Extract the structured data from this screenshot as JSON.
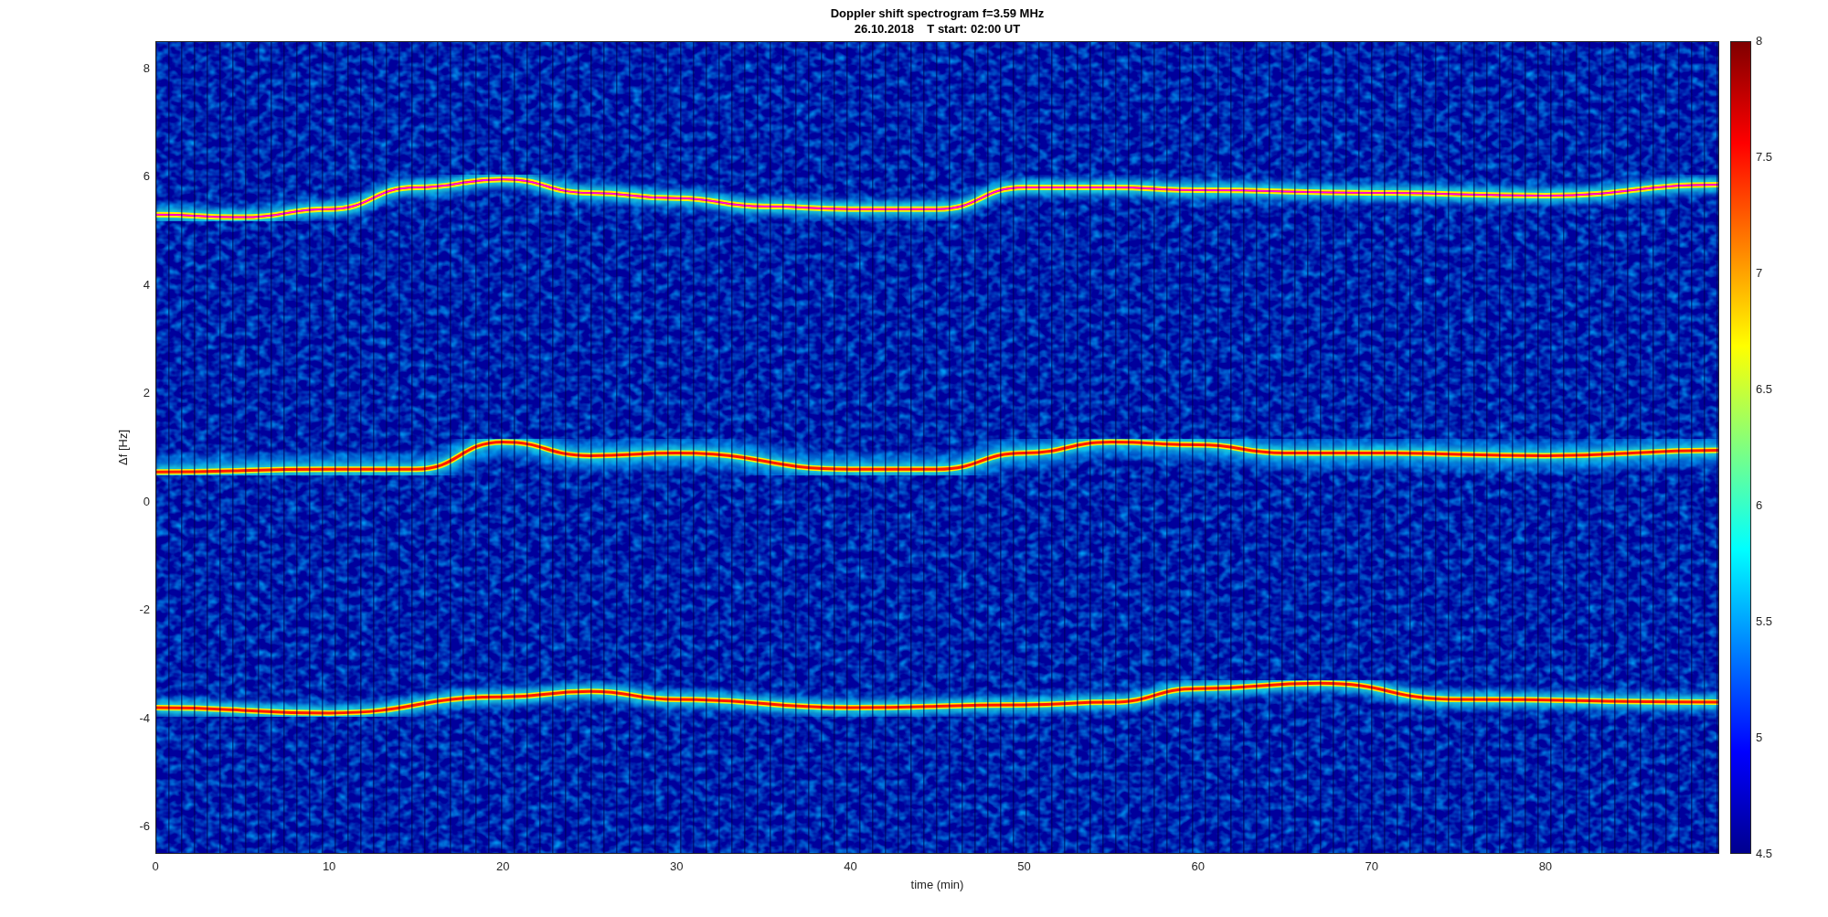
{
  "figure": {
    "title_lines": [
      "Doppler shift spectrogram f=3.59 MHz",
      "26.10.2018    T start: 02:00 UT"
    ],
    "axes": {
      "ylabel": "Δf [Hz]",
      "xlabel": "time (min)",
      "yticks": [
        "8",
        "6",
        "4",
        "2",
        "0",
        "-2",
        "-4",
        "-6"
      ],
      "xticks": [
        "0",
        "10",
        "20",
        "30",
        "40",
        "50",
        "60",
        "70",
        "80"
      ]
    },
    "colorbar": {
      "ticks": [
        "8",
        "7.5",
        "7",
        "6.5",
        "6",
        "5.5",
        "5",
        "4.5"
      ]
    }
  }
}
